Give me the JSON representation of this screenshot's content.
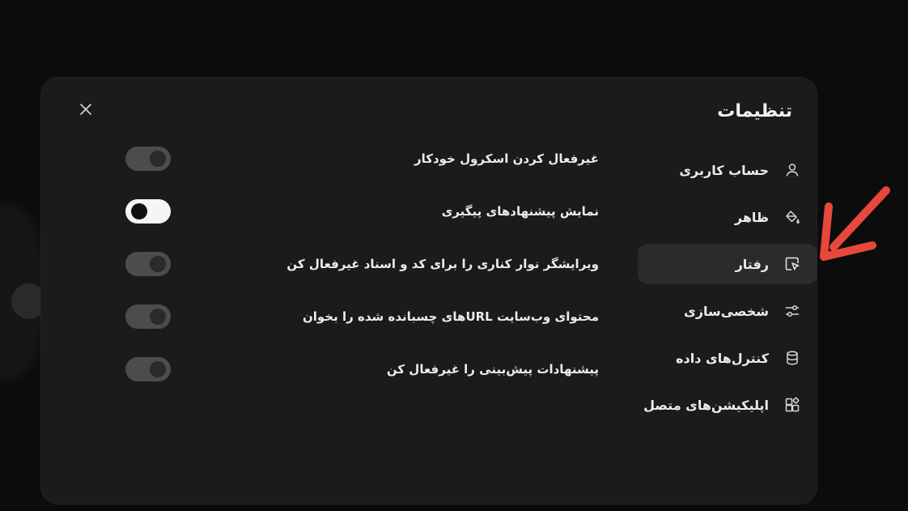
{
  "modal": {
    "title": "تنظیمات",
    "close_icon": "close-icon"
  },
  "sidebar": {
    "items": [
      {
        "label": "حساب کاربری",
        "icon": "user-icon",
        "active": false
      },
      {
        "label": "ظاهر",
        "icon": "paint-bucket-icon",
        "active": false
      },
      {
        "label": "رفتار",
        "icon": "cursor-click-icon",
        "active": true
      },
      {
        "label": "شخصی‌سازی",
        "icon": "sliders-icon",
        "active": false
      },
      {
        "label": "کنترل‌های داده",
        "icon": "database-icon",
        "active": false
      },
      {
        "label": "اپلیکیشن‌های متصل",
        "icon": "apps-grid-icon",
        "active": false
      }
    ]
  },
  "settings": [
    {
      "label": "غیرفعال کردن اسکرول خودکار",
      "enabled": false
    },
    {
      "label": "نمایش پیشنهادهای پیگیری",
      "enabled": true
    },
    {
      "label": "ویرایشگر نوار کناری را برای کد و اسناد غیرفعال کن",
      "enabled": false
    },
    {
      "label": "محتوای وب‌سایت URLهای چسبانده شده را بخوان",
      "enabled": false
    },
    {
      "label": "پیشنهادات پیش‌بینی را غیرفعال کن",
      "enabled": false
    }
  ],
  "annotation": {
    "arrow_color": "#e8473b",
    "points_to": "رفتار"
  },
  "colors": {
    "modal_bg": "#1b1b1b",
    "active_item_bg": "#2b2b2b",
    "toggle_off": "#4c4c4c",
    "toggle_on": "#f5f5f5"
  }
}
